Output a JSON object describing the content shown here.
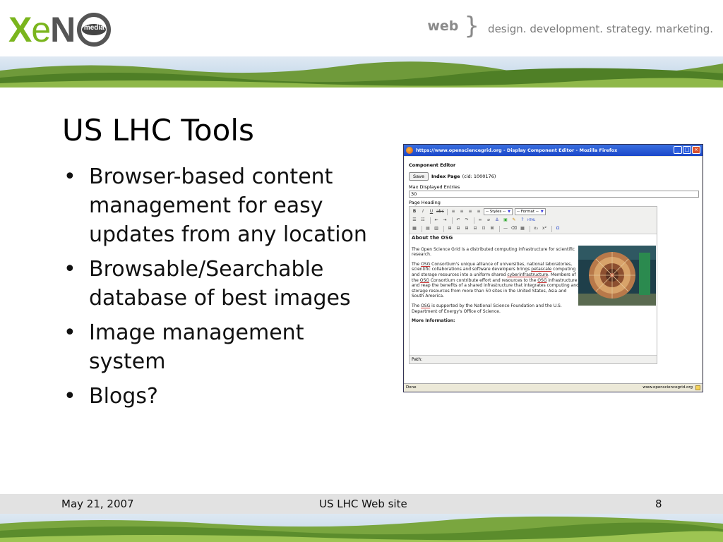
{
  "header": {
    "logo": "XENO media",
    "tagline_web": "web",
    "tagline_words": "design. development. strategy. marketing."
  },
  "slide": {
    "title": "US LHC Tools",
    "bullets": [
      "Browser-based content management for easy updates from any location",
      "Browsable/Searchable database of best images",
      "Image management system",
      "Blogs?"
    ]
  },
  "browser": {
    "window_title": "https://www.opensciencegrid.org - Display Component Editor - Mozilla Firefox",
    "component_editor_label": "Component Editor",
    "save_label": "Save",
    "index_page_label": "Index Page",
    "cid_text": "(cid: 1000176)",
    "max_entries_label": "Max Displayed Entries",
    "max_entries_value": "30",
    "page_heading_label": "Page Heading",
    "toolbar": {
      "styles_select": "-- Styles --",
      "format_select": "-- Format --"
    },
    "editor": {
      "heading": "About the OSG",
      "p1": "The Open Science Grid is a distributed computing infrastructure for scientific research.",
      "p2_a": "The ",
      "osg": "OSG",
      "p2_b": " Consortium's unique alliance of universities, national laboratories, scientific collaborations and software developers brings ",
      "petascale": "petascale",
      "p2_c": " computing and storage resources into a uniform shared ",
      "cyberinfrastructure": "cyberinfrastructure",
      "p2_d": ". Members of the ",
      "p2_e": " Consortium contribute effort and resources to the ",
      "p2_f": " infrastructure and reap the benefits of a shared infrastructure that integrates computing and storage resources from more than 50 sites in the United States, Asia and South America.",
      "p3_a": "The ",
      "p3_b": " is supported by the National Science Foundation and the U.S. Department of Energy's Office of Science.",
      "more_info": "More Information:",
      "path_label": "Path:"
    },
    "status_left": "Done",
    "status_right": "www.opensciencegrid.org"
  },
  "footer": {
    "date": "May 21, 2007",
    "site": "US LHC Web site",
    "page_number": "8"
  },
  "colors": {
    "logo_green": "#7ab51d",
    "titlebar_blue": "#1b47c9",
    "footer_gray": "#e2e2e2"
  }
}
